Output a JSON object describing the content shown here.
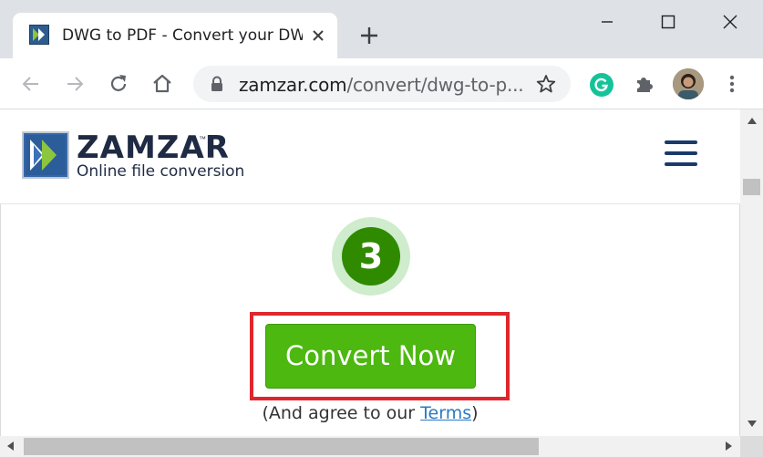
{
  "browser": {
    "tab_title": "DWG to PDF - Convert your DWG",
    "url_host": "zamzar.com",
    "url_path": "/convert/dwg-to-p..."
  },
  "site": {
    "brand": "ZAMZAR",
    "trademark": "™",
    "tagline": "Online file conversion"
  },
  "step": {
    "number": "3"
  },
  "convert": {
    "button_label": "Convert Now",
    "agree_prefix": "(And agree to our ",
    "terms_link": "Terms",
    "agree_suffix": ")"
  },
  "colors": {
    "button_green": "#4cb810",
    "step_green": "#2f8a00",
    "highlight_red": "#e0262c",
    "link_blue": "#2a7ac2",
    "brand_navy": "#1f2a44"
  }
}
